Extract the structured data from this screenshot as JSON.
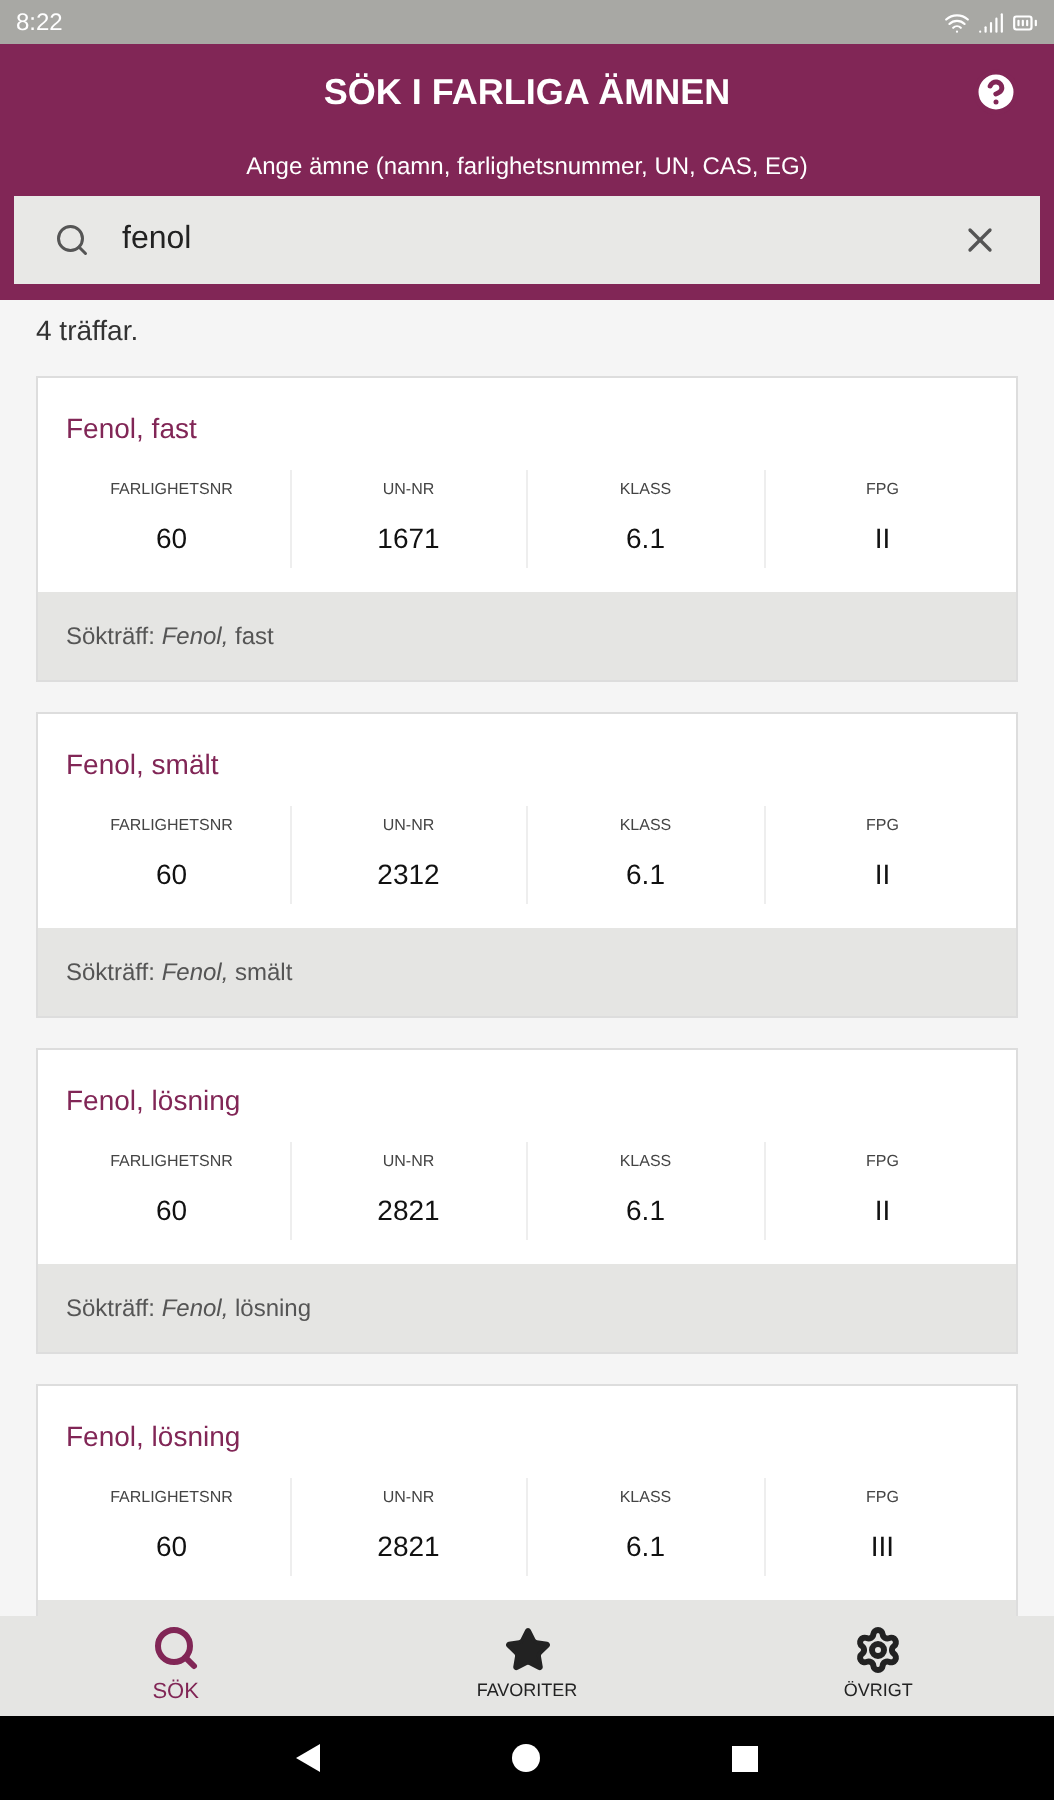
{
  "status_bar": {
    "time": "8:22"
  },
  "header": {
    "title": "SÖK I FARLIGA ÄMNEN",
    "hint": "Ange ämne (namn, farlighetsnummer, UN, CAS, EG)"
  },
  "search": {
    "value": "fenol"
  },
  "result_count": "4 träffar.",
  "results": [
    {
      "name": "Fenol, fast",
      "fields": [
        {
          "label": "FARLIGHETSNR",
          "value": "60"
        },
        {
          "label": "UN-NR",
          "value": "1671"
        },
        {
          "label": "KLASS",
          "value": "6.1"
        },
        {
          "label": "FPG",
          "value": "II"
        }
      ],
      "match": "Sökträff: *Fenol,* fast"
    },
    {
      "name": "Fenol, smält",
      "fields": [
        {
          "label": "FARLIGHETSNR",
          "value": "60"
        },
        {
          "label": "UN-NR",
          "value": "2312"
        },
        {
          "label": "KLASS",
          "value": "6.1"
        },
        {
          "label": "FPG",
          "value": "II"
        }
      ],
      "match": "Sökträff: *Fenol,* smält"
    },
    {
      "name": "Fenol, lösning",
      "fields": [
        {
          "label": "FARLIGHETSNR",
          "value": "60"
        },
        {
          "label": "UN-NR",
          "value": "2821"
        },
        {
          "label": "KLASS",
          "value": "6.1"
        },
        {
          "label": "FPG",
          "value": "II"
        }
      ],
      "match": "Sökträff: *Fenol,* lösning"
    },
    {
      "name": "Fenol, lösning",
      "fields": [
        {
          "label": "FARLIGHETSNR",
          "value": "60"
        },
        {
          "label": "UN-NR",
          "value": "2821"
        },
        {
          "label": "KLASS",
          "value": "6.1"
        },
        {
          "label": "FPG",
          "value": "III"
        }
      ]
    }
  ],
  "nav": [
    {
      "kind": "search",
      "label": "SÖK",
      "selected": true
    },
    {
      "kind": "favorites",
      "label": "FAVORITER",
      "selected": false
    },
    {
      "kind": "settings",
      "label": "ÖVRIGT",
      "selected": false
    }
  ]
}
